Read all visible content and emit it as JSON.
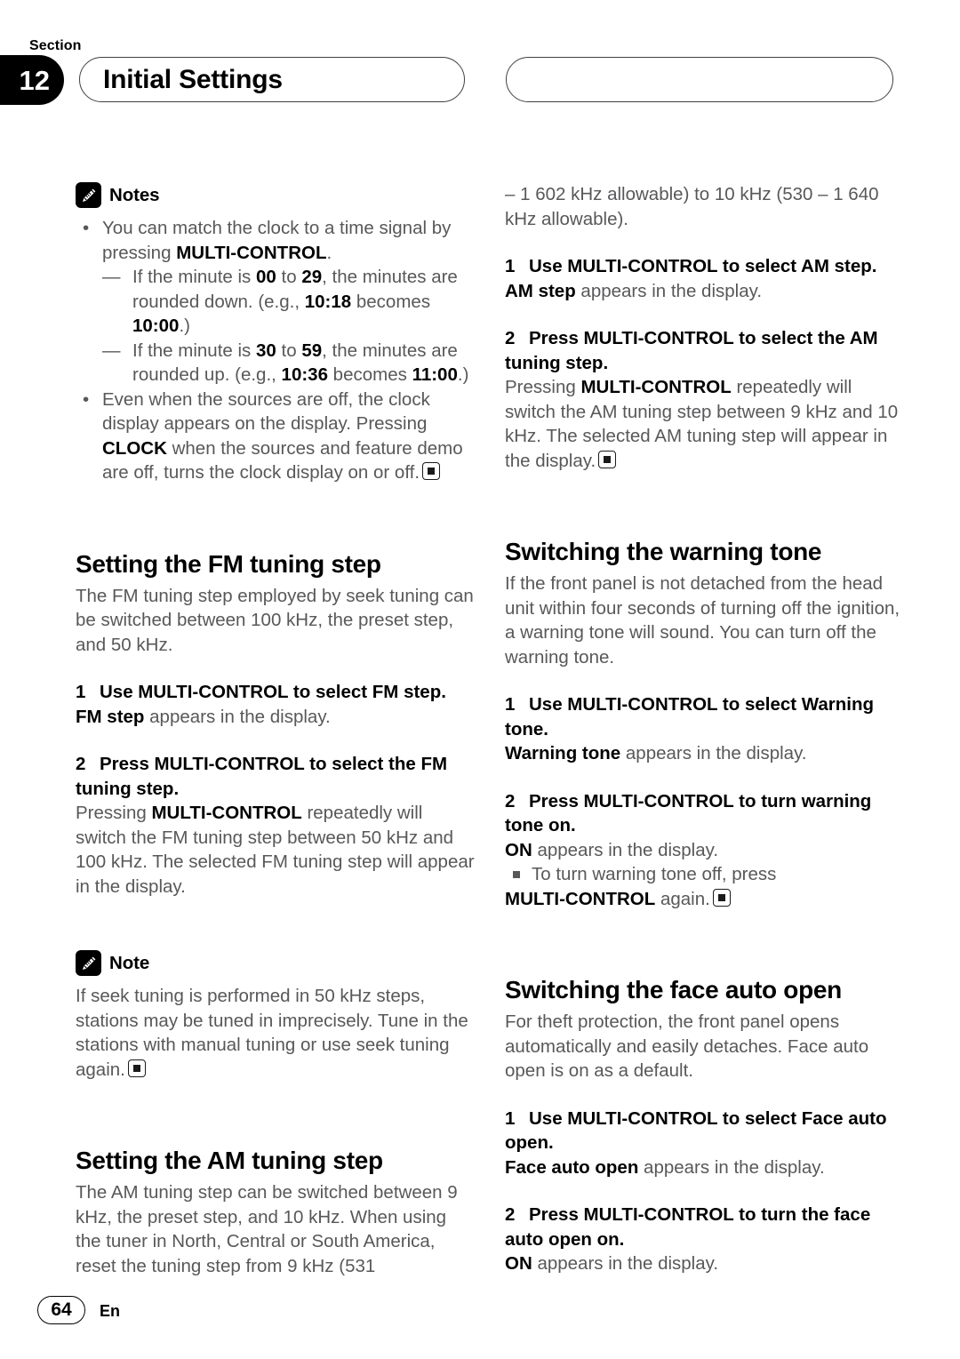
{
  "header": {
    "section_label": "Section",
    "section_number": "12",
    "title": "Initial Settings"
  },
  "footer": {
    "page_number": "64",
    "language": "En"
  },
  "left_column": {
    "notes_block": {
      "icon": "pencil-icon",
      "title": "Notes",
      "bullets": [
        {
          "lead": "You can match the clock to a time signal by pressing ",
          "bold": "MULTI-CONTROL",
          "tail": ".",
          "sub_items": [
            {
              "p1": "If the minute is ",
              "b1": "00",
              "p2": " to ",
              "b2": "29",
              "p3": ", the minutes are rounded down. (e.g., ",
              "b3": "10:18",
              "p4": " becomes ",
              "b4": "10:00",
              "p5": ".)"
            },
            {
              "p1": "If the minute is ",
              "b1": "30",
              "p2": " to ",
              "b2": "59",
              "p3": ", the minutes are rounded up. (e.g., ",
              "b3": "10:36",
              "p4": " becomes ",
              "b4": "11:00",
              "p5": ".)"
            }
          ]
        },
        {
          "lead": "Even when the sources are off, the clock display appears on the display. Pressing ",
          "bold": "CLOCK",
          "tail": " when the sources and feature demo are off, turns the clock display on or off."
        }
      ]
    },
    "fm_section": {
      "heading": "Setting the FM tuning step",
      "intro": "The FM tuning step employed by seek tuning can be switched between 100 kHz, the preset step, and 50 kHz.",
      "step1": {
        "num": "1",
        "title": "Use MULTI-CONTROL to select FM step.",
        "result_bold": "FM step",
        "result_rest": " appears in the display."
      },
      "step2": {
        "num": "2",
        "title": "Press MULTI-CONTROL to select the FM tuning step.",
        "body_pre": "Pressing ",
        "body_bold": "MULTI-CONTROL",
        "body_post": " repeatedly will switch the FM tuning step between 50 kHz and 100 kHz. The selected FM tuning step will appear in the display."
      },
      "note_block": {
        "icon": "pencil-icon",
        "title": "Note",
        "text": "If seek tuning is performed in 50 kHz steps, stations may be tuned in imprecisely. Tune in the stations with manual tuning or use seek tuning again."
      }
    },
    "am_section": {
      "heading": "Setting the AM tuning step",
      "intro": "The AM tuning step can be switched between 9 kHz, the preset step, and 10 kHz. When using the tuner in North, Central or South America, reset the tuning step from 9 kHz (531"
    }
  },
  "right_column": {
    "am_continued": "– 1 602 kHz allowable) to 10 kHz (530 – 1 640 kHz allowable).",
    "am_step1": {
      "num": "1",
      "title": "Use MULTI-CONTROL to select AM step.",
      "result_bold": "AM step",
      "result_rest": " appears in the display."
    },
    "am_step2": {
      "num": "2",
      "title": "Press MULTI-CONTROL to select the AM tuning step.",
      "body_pre": "Pressing ",
      "body_bold": "MULTI-CONTROL",
      "body_post": " repeatedly will switch the AM tuning step between 9 kHz and 10 kHz. The selected AM tuning step will appear in the display."
    },
    "warning_section": {
      "heading": "Switching the warning tone",
      "intro": "If the front panel is not detached from the head unit within four seconds of turning off the ignition, a warning tone will sound. You can turn off the warning tone.",
      "step1": {
        "num": "1",
        "title": "Use MULTI-CONTROL to select Warning tone.",
        "result_bold": "Warning tone",
        "result_rest": " appears in the display."
      },
      "step2": {
        "num": "2",
        "title": "Press MULTI-CONTROL to turn warning tone on.",
        "result_bold": "ON",
        "result_rest": " appears in the display.",
        "sub_pre": "To turn warning tone off, press ",
        "sub_bold": "MULTI-CONTROL",
        "sub_post": " again."
      }
    },
    "face_section": {
      "heading": "Switching the face auto open",
      "intro": "For theft protection, the front panel opens automatically and easily detaches. Face auto open is on as a default.",
      "step1": {
        "num": "1",
        "title": "Use MULTI-CONTROL to select Face auto open.",
        "result_bold": "Face auto open",
        "result_rest": " appears in the display."
      },
      "step2": {
        "num": "2",
        "title": "Press MULTI-CONTROL to turn the face auto open on.",
        "result_bold": "ON",
        "result_rest": " appears in the display."
      }
    }
  }
}
